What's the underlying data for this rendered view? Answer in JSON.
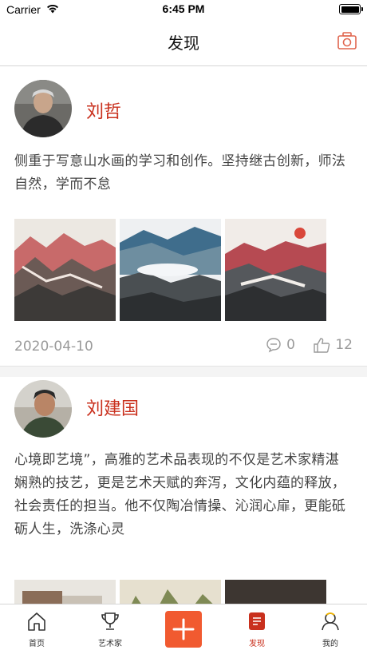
{
  "status": {
    "carrier": "Carrier",
    "time": "6:45 PM"
  },
  "nav": {
    "title": "发现",
    "camera_icon": "camera-icon"
  },
  "posts": [
    {
      "name": "刘哲",
      "text": "侧重于写意山水画的学习和创作。坚持继古创新，师法自然，学而不怠",
      "date": "2020-04-10",
      "comments": "0",
      "likes": "12"
    },
    {
      "name": "刘建国",
      "text": "心境即艺境”，高雅的艺术品表现的不仅是艺术家精湛娴熟的技艺，更是艺术天赋的奔泻，文化内蕴的释放，社会责任的担当。他不仅陶冶情操、沁润心扉，更能砥砺人生，洗涤心灵"
    }
  ],
  "tabs": [
    {
      "label": "首页",
      "icon": "home-icon"
    },
    {
      "label": "艺术家",
      "icon": "trophy-icon"
    },
    {
      "label": "",
      "icon": "plus-icon"
    },
    {
      "label": "发现",
      "icon": "discover-icon"
    },
    {
      "label": "我的",
      "icon": "user-icon"
    }
  ],
  "colors": {
    "accent": "#c9301d",
    "add_button": "#f15a30"
  }
}
